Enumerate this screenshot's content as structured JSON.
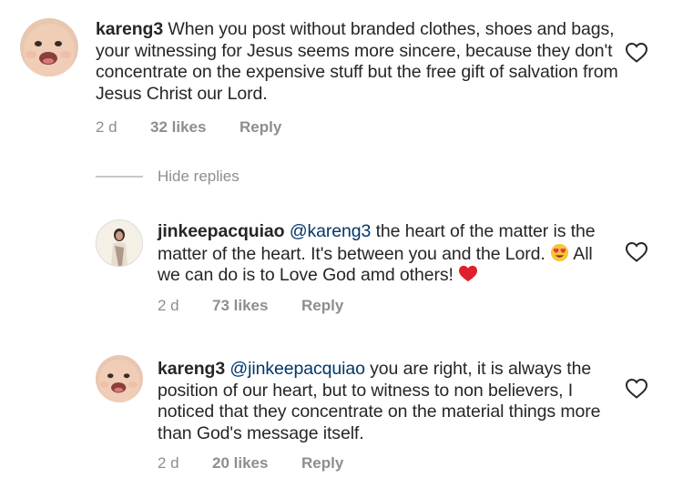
{
  "comments": [
    {
      "username": "kareng3",
      "mention": "",
      "text": " When you post without branded clothes, shoes and bags, your witnessing for Jesus seems more sincere, because they don't concentrate on  the expensive stuff but the free gift of salvation from Jesus Christ our Lord.",
      "time": "2 d",
      "likes": "32 likes",
      "reply": "Reply",
      "avatar_icon": "baby-avatar"
    },
    {
      "username": "jinkeepacquiao",
      "mention": "@kareng3",
      "text_part1": " the heart of the matter is the matter of the heart. It's between you and the Lord. ",
      "emoji1": "heart-eyes-emoji",
      "text_part2": " All we can do is to Love God amd others! ",
      "emoji2": "red-heart-emoji",
      "time": "2 d",
      "likes": "73 likes",
      "reply": "Reply",
      "avatar_icon": "woman-avatar"
    },
    {
      "username": "kareng3",
      "mention": "@jinkeepacquiao",
      "text": " you are right, it is always the position of our heart, but to witness to non believers, I noticed that they concentrate on the material things more than God's message itself.",
      "time": "2 d",
      "likes": "20 likes",
      "reply": "Reply",
      "avatar_icon": "baby-avatar"
    }
  ],
  "hide_replies": "Hide replies",
  "colors": {
    "text": "#262626",
    "mention": "#00376b",
    "meta": "#8e8e8e",
    "divider": "#c7c7c7"
  }
}
